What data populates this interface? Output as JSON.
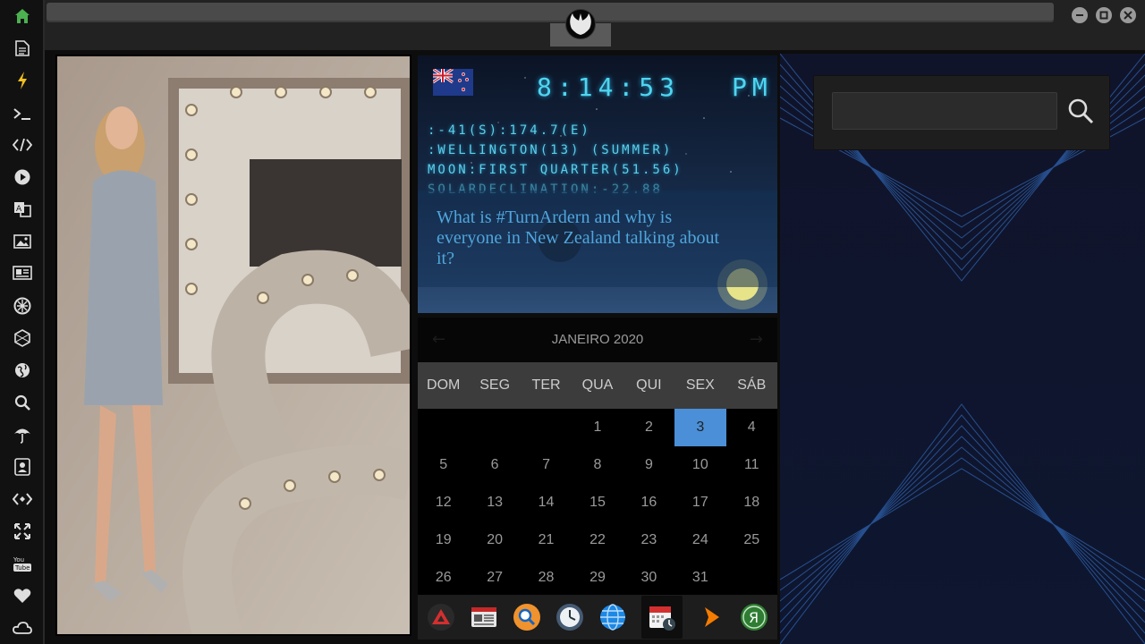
{
  "sidebar": {
    "items": [
      {
        "icon": "home-icon"
      },
      {
        "icon": "document-icon"
      },
      {
        "icon": "lightning-icon"
      },
      {
        "icon": "terminal-icon"
      },
      {
        "icon": "code-icon"
      },
      {
        "icon": "play-icon"
      },
      {
        "icon": "translate-icon"
      },
      {
        "icon": "image-icon"
      },
      {
        "icon": "newspaper-icon"
      },
      {
        "icon": "rebel-alliance-icon"
      },
      {
        "icon": "hexagon-icon"
      },
      {
        "icon": "globe-icon"
      },
      {
        "icon": "search-icon"
      },
      {
        "icon": "umbrella-icon"
      },
      {
        "icon": "contact-card-icon"
      },
      {
        "icon": "embed-icon"
      },
      {
        "icon": "fullscreen-icon"
      },
      {
        "icon": "youtube-icon"
      },
      {
        "icon": "heart-icon"
      },
      {
        "icon": "cloud-icon"
      }
    ],
    "accent": "#4caf50"
  },
  "window": {
    "emblem_icon": "rebel-alliance-icon",
    "buttons": [
      "minimize-icon",
      "maximize-icon",
      "close-icon"
    ]
  },
  "clock": {
    "time": "8:14:53",
    "meridiem": "PM",
    "flag": "new-zealand-flag",
    "coords": ":-41(S):174.7(E)",
    "location": ":WELLINGTON(13) (SUMMER)",
    "moon": "MOON:FIRST QUARTER(51.56)",
    "solar": "SOLARDECLINATION:-22.88"
  },
  "news": {
    "headline": "What is #TurnArdern and why is everyone in New Zealand talking about it?"
  },
  "calendar": {
    "title": "JANEIRO 2020",
    "weekdays": [
      "DOM",
      "SEG",
      "TER",
      "QUA",
      "QUI",
      "SEX",
      "SÁB"
    ],
    "weeks": [
      [
        "",
        "",
        "",
        "1",
        "2",
        "3",
        "4"
      ],
      [
        "5",
        "6",
        "7",
        "8",
        "9",
        "10",
        "11"
      ],
      [
        "12",
        "13",
        "14",
        "15",
        "16",
        "17",
        "18"
      ],
      [
        "19",
        "20",
        "21",
        "22",
        "23",
        "24",
        "25"
      ],
      [
        "26",
        "27",
        "28",
        "29",
        "30",
        "31",
        ""
      ]
    ],
    "today": "3",
    "highlight_color": "#4a8fd8"
  },
  "dock": {
    "apps": [
      {
        "name": "red-triangle-app-icon"
      },
      {
        "name": "news-app-icon"
      },
      {
        "name": "search-app-icon"
      },
      {
        "name": "clock-app-icon"
      },
      {
        "name": "globe-app-icon"
      },
      {
        "name": "calendar-app-icon",
        "active": true
      },
      {
        "name": "arrow-app-icon"
      },
      {
        "name": "yandex-app-icon"
      }
    ]
  },
  "search": {
    "value": "",
    "placeholder": ""
  }
}
